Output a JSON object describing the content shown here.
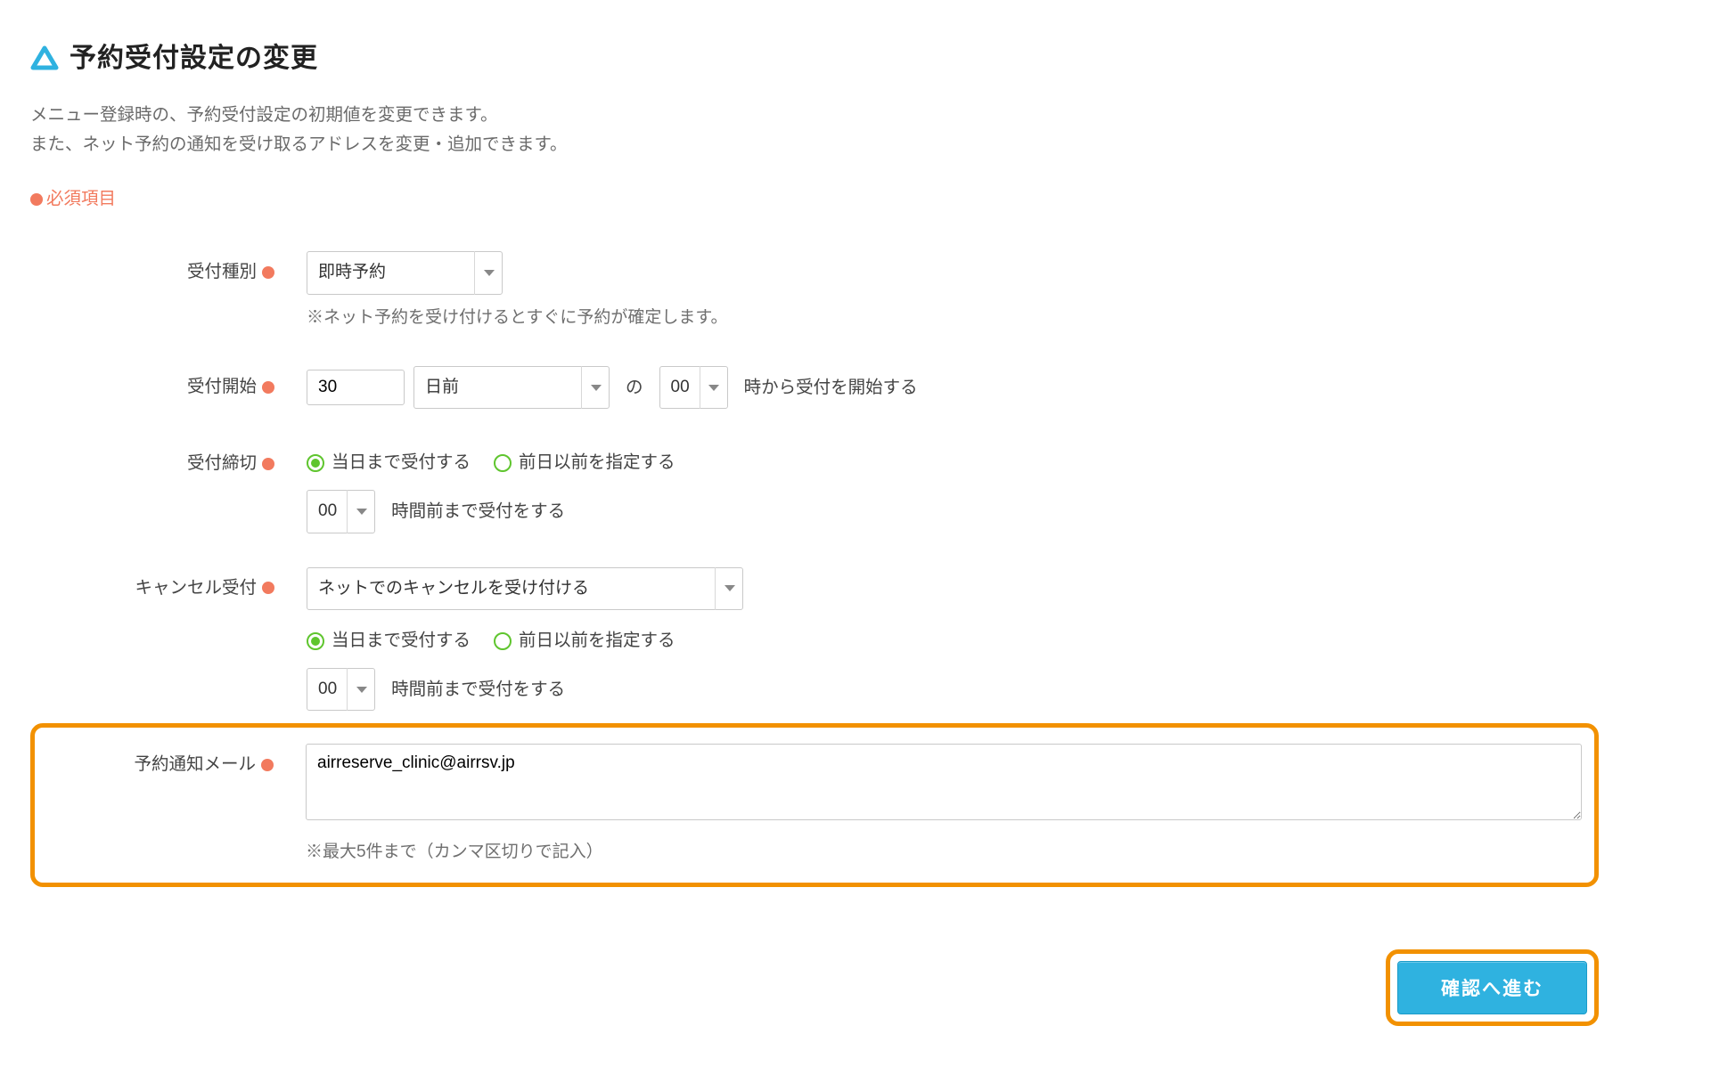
{
  "page": {
    "title": "予約受付設定の変更",
    "description_line1": "メニュー登録時の、予約受付設定の初期値を変更できます。",
    "description_line2": "また、ネット予約の通知を受け取るアドレスを変更・追加できます。",
    "required_label": "必須項目"
  },
  "fields": {
    "reception_type": {
      "label": "受付種別",
      "value": "即時予約",
      "hint": "※ネット予約を受け付けるとすぐに予約が確定します。"
    },
    "reception_start": {
      "label": "受付開始",
      "days_value": "30",
      "unit_value": "日前",
      "mid_text": "の",
      "hour_value": "00",
      "suffix": "時から受付を開始する"
    },
    "reception_deadline": {
      "label": "受付締切",
      "radio_same_day": "当日まで受付する",
      "radio_prev_day": "前日以前を指定する",
      "hour_value": "00",
      "suffix": "時間前まで受付をする"
    },
    "cancel_reception": {
      "label": "キャンセル受付",
      "value": "ネットでのキャンセルを受け付ける",
      "radio_same_day": "当日まで受付する",
      "radio_prev_day": "前日以前を指定する",
      "hour_value": "00",
      "suffix": "時間前まで受付をする"
    },
    "notify_email": {
      "label": "予約通知メール",
      "value": "airreserve_clinic@airrsv.jp",
      "hint": "※最大5件まで（カンマ区切りで記入）"
    }
  },
  "actions": {
    "submit": "確認へ進む"
  }
}
